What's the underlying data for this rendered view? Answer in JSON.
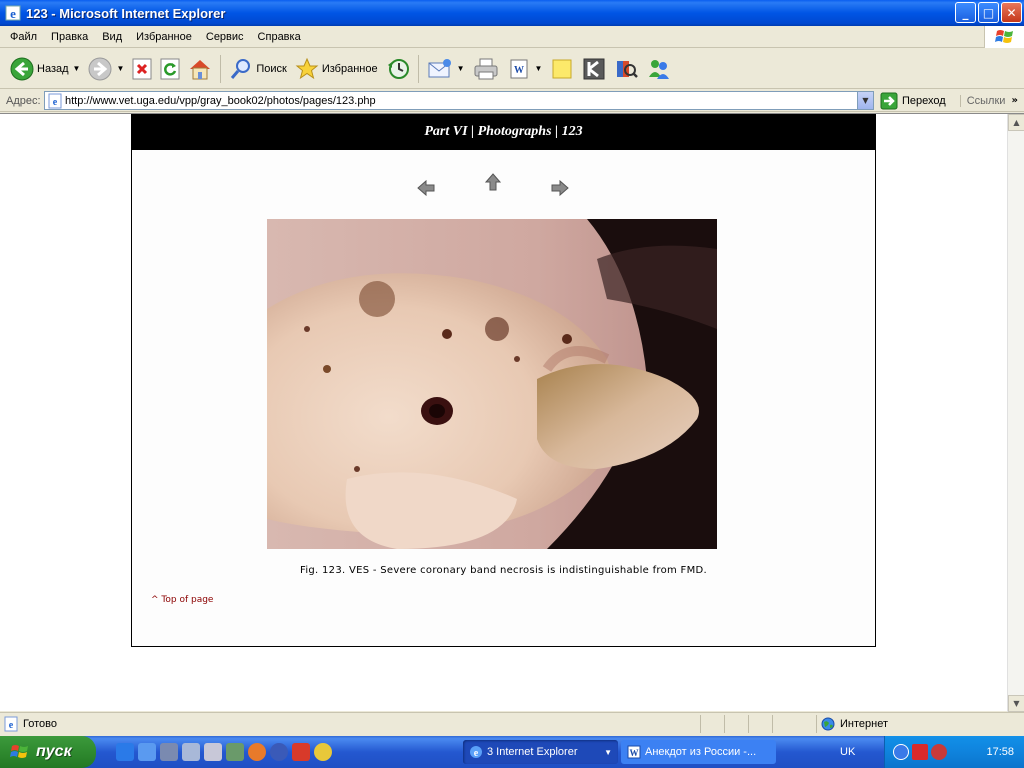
{
  "window": {
    "title": "123 - Microsoft Internet Explorer",
    "controls": {
      "minimize": "_",
      "maximize": "□",
      "close": "✕"
    }
  },
  "menu": [
    "Файл",
    "Правка",
    "Вид",
    "Избранное",
    "Сервис",
    "Справка"
  ],
  "toolbar": {
    "back_label": "Назад",
    "search_label": "Поиск",
    "favorites_label": "Избранное"
  },
  "address": {
    "label": "Адрес:",
    "url": "http://www.vet.uga.edu/vpp/gray_book02/photos/pages/123.php",
    "go_label": "Переход",
    "links_label": "Ссылки",
    "more": "»"
  },
  "page": {
    "header": "Part VI | Photographs | 123",
    "caption": "Fig. 123.  VES - Severe coronary band necrosis is indistinguishable from FMD.",
    "top_link": "^ Top of page"
  },
  "status": {
    "text": "Готово",
    "zone": "Интернет"
  },
  "taskbar": {
    "start_label": "пуск",
    "tasks": [
      {
        "label": "3 Internet Explorer"
      },
      {
        "label": "Анекдот из России -..."
      }
    ],
    "language": "UK",
    "clock": "17:58"
  },
  "colors": {
    "titlebar": "#0055e5",
    "page_header": "#000000",
    "top_link": "#8b0000",
    "start": "#2f8a2f"
  }
}
